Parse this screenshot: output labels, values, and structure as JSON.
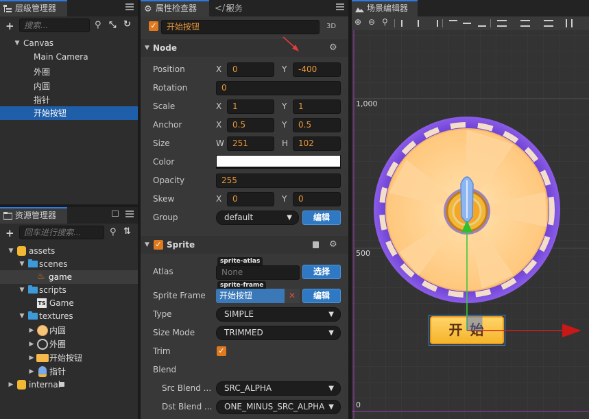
{
  "hierarchy": {
    "title": "层级管理器",
    "search_placeholder": "搜索...",
    "nodes": [
      "Canvas",
      "Main Camera",
      "外圈",
      "内圆",
      "指针",
      "开始按钮"
    ]
  },
  "assets": {
    "title": "资源管理器",
    "search_placeholder": "回车进行搜索...",
    "items": [
      "assets",
      "scenes",
      "game",
      "scripts",
      "Game",
      "textures",
      "内圆",
      "外圈",
      "开始按钮",
      "指针",
      "internal"
    ],
    "ts_badge": "TS"
  },
  "inspector": {
    "tab_title": "属性检查器",
    "tab2_title": "服务",
    "node_name": "开始按钮",
    "mode_3d": "3D",
    "node_section": "Node",
    "position": {
      "label": "Position",
      "x_axis": "X",
      "x": "0",
      "y_axis": "Y",
      "y": "-400"
    },
    "rotation": {
      "label": "Rotation",
      "value": "0"
    },
    "scale": {
      "label": "Scale",
      "x_axis": "X",
      "x": "1",
      "y_axis": "Y",
      "y": "1"
    },
    "anchor": {
      "label": "Anchor",
      "x_axis": "X",
      "x": "0.5",
      "y_axis": "Y",
      "y": "0.5"
    },
    "size": {
      "label": "Size",
      "w_axis": "W",
      "w": "251",
      "h_axis": "H",
      "h": "102"
    },
    "color": {
      "label": "Color",
      "value": "#ffffff"
    },
    "opacity": {
      "label": "Opacity",
      "value": "255"
    },
    "skew": {
      "label": "Skew",
      "x_axis": "X",
      "x": "0",
      "y_axis": "Y",
      "y": "0"
    },
    "group": {
      "label": "Group",
      "value": "default",
      "edit": "编辑"
    },
    "sprite_section": "Sprite",
    "atlas": {
      "label": "Atlas",
      "tag": "sprite-atlas",
      "value": "None",
      "select": "选择"
    },
    "sprite_frame": {
      "label": "Sprite Frame",
      "tag": "sprite-frame",
      "value": "开始按钮",
      "edit": "编辑"
    },
    "type": {
      "label": "Type",
      "value": "SIMPLE"
    },
    "size_mode": {
      "label": "Size Mode",
      "value": "TRIMMED"
    },
    "trim": {
      "label": "Trim"
    },
    "blend": {
      "label": "Blend"
    },
    "src_blend": {
      "label": "Src Blend ...",
      "value": "SRC_ALPHA"
    },
    "dst_blend": {
      "label": "Dst Blend ...",
      "value": "ONE_MINUS_SRC_ALPHA"
    }
  },
  "scene": {
    "title": "场景编辑器",
    "ruler": [
      "1,000",
      "500",
      "0"
    ],
    "button_text": "开 始"
  },
  "colors": {
    "accent_blue": "#2f79c4",
    "selection": "#1f5ea8",
    "value_orange": "#e8963a",
    "checkbox_orange": "#e07a1f"
  }
}
